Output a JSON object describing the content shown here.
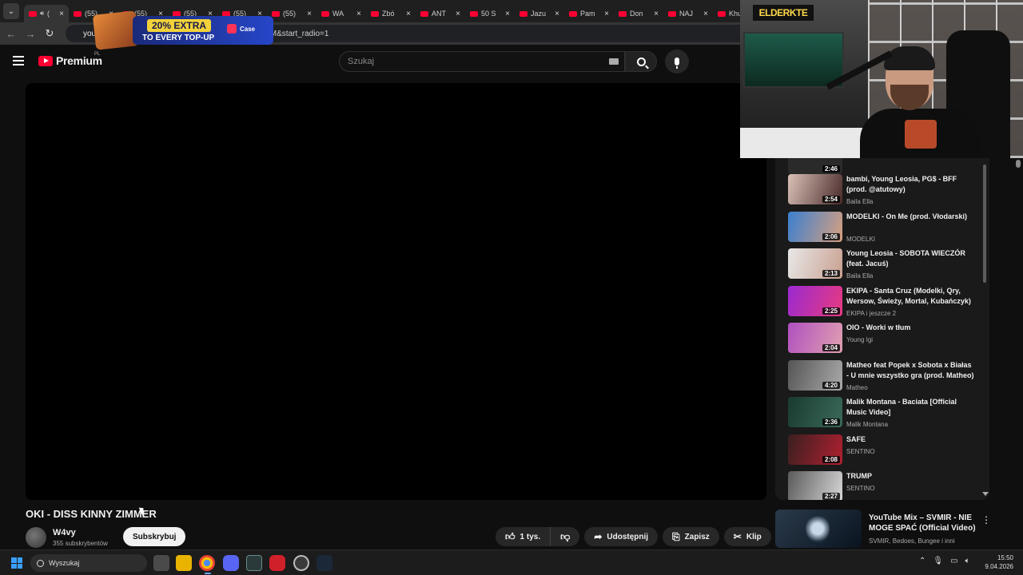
{
  "tabs": [
    {
      "label": "(",
      "active": true
    },
    {
      "label": "(55)",
      "active": false
    },
    {
      "label": "(55)",
      "active": false
    },
    {
      "label": "(55)",
      "active": false
    },
    {
      "label": "(55)",
      "active": false
    },
    {
      "label": "(55)",
      "active": false
    },
    {
      "label": "WA",
      "active": false
    },
    {
      "label": "Zbó",
      "active": false
    },
    {
      "label": "ANT",
      "active": false
    },
    {
      "label": "50 S",
      "active": false
    },
    {
      "label": "Jazu",
      "active": false
    },
    {
      "label": "Pam",
      "active": false
    },
    {
      "label": "Don",
      "active": false
    },
    {
      "label": "NAJ",
      "active": false
    },
    {
      "label": "Khu",
      "active": false
    }
  ],
  "address": {
    "domain": "you",
    "path": "McMM&start_radio=1"
  },
  "ad": {
    "line1": "20% EXTRA",
    "line2": "TO EVERY TOP-UP",
    "brand": "Case"
  },
  "header": {
    "logo_text": "Premium",
    "country": "PL",
    "search_placeholder": "Szukaj"
  },
  "video": {
    "title": "OKI - DISS KINNY ZIMMER",
    "channel": "W4vy",
    "subscribers": "355 subskrybentów",
    "subscribe_label": "Subskrybuj",
    "likes": "1 tys.",
    "share_label": "Udostępnij",
    "save_label": "Zapisz",
    "clip_label": "Klip"
  },
  "webcam": {
    "badge": "ELDERKTE"
  },
  "playlist": {
    "partial_duration": "2:46",
    "items": [
      {
        "title": "bambi, Young Leosia, PG$ - BFF (prod. @atutowy)",
        "artist": "Baila Ella",
        "duration": "2:54",
        "color_a": "#d9c2b8",
        "color_b": "#4a2a2a"
      },
      {
        "title": "MODELKI - On Me (prod. Vłodarski)",
        "artist": "MODELKI",
        "duration": "2:06",
        "color_a": "#3a7fd0",
        "color_b": "#d8a080"
      },
      {
        "title": "Young Leosia - SOBOTA WIECZÓR (feat. Jacuś)",
        "artist": "Baila Ella",
        "duration": "2:13",
        "color_a": "#e8e8e8",
        "color_b": "#c9a090"
      },
      {
        "title": "EKIPA - Santa Cruz (Modelki, Qry, Wersow, Świeży, Mortal, Kubańczyk)",
        "artist": "EKIPA i jeszcze 2",
        "duration": "2:25",
        "color_a": "#9a2ad0",
        "color_b": "#e83a80"
      },
      {
        "title": "OIO - Worki w tłum",
        "artist": "Young Igi",
        "duration": "2:04",
        "color_a": "#b050c0",
        "color_b": "#e0a0b0"
      },
      {
        "title": "Matheo feat Popek x Sobota x Białas - U mnie wszystko gra (prod. Matheo)",
        "artist": "Matheo",
        "duration": "4:20",
        "color_a": "#555555",
        "color_b": "#aaaaaa"
      },
      {
        "title": "Malik Montana - Baciata [Official Music Video]",
        "artist": "Malik Montana",
        "duration": "2:36",
        "color_a": "#1a3a30",
        "color_b": "#3a6a5a"
      },
      {
        "title": "SAFE",
        "artist": "SENTINO",
        "duration": "2:08",
        "color_a": "#3a2020",
        "color_b": "#b02030"
      },
      {
        "title": "TRUMP",
        "artist": "SENTINO",
        "duration": "2:27",
        "color_a": "#5a5a5a",
        "color_b": "#d8d8d8"
      }
    ]
  },
  "recommendation": {
    "title": "YouTube Mix – SVMIR - NIE MOGE SPAĆ (Official Video)",
    "subtitle": "SVMIR, Bedoes, Bungee i inni"
  },
  "taskbar": {
    "search_label": "Wyszukaj",
    "time": "15:50",
    "date": "9.04.2026"
  }
}
